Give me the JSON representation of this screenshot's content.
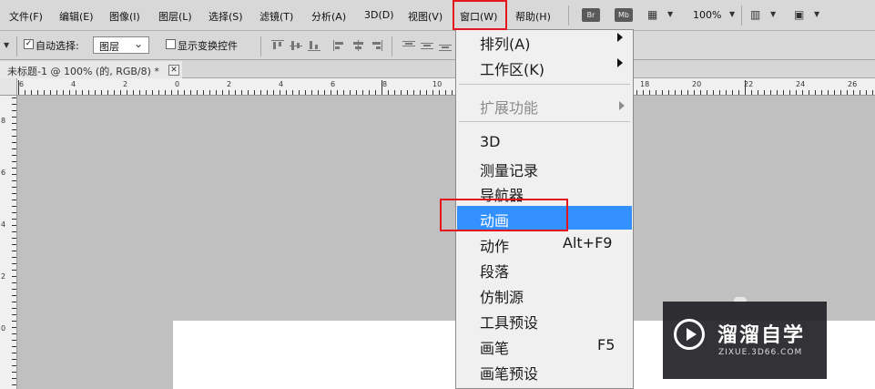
{
  "menubar": {
    "items": [
      "文件(F)",
      "编辑(E)",
      "图像(I)",
      "图层(L)",
      "选择(S)",
      "滤镜(T)",
      "分析(A)",
      "3D(D)",
      "视图(V)",
      "窗口(W)",
      "帮助(H)"
    ],
    "br_label": "Br",
    "mb_label": "Mb",
    "zoom": "100%"
  },
  "options": {
    "auto_select_label": "自动选择:",
    "layer_select_value": "图层",
    "show_transform_label": "显示变换控件"
  },
  "document_tab": {
    "title": "未标题-1 @ 100% (的, RGB/8) *",
    "close": "✕"
  },
  "ruler": {
    "h_labels": [
      "6",
      "4",
      "2",
      "0",
      "2",
      "4",
      "6",
      "8",
      "10",
      "18",
      "20",
      "22",
      "24",
      "26"
    ],
    "v_labels": [
      "8",
      "6",
      "4",
      "2",
      "0"
    ]
  },
  "window_menu": {
    "arrange": "排列(A)",
    "workspace": "工作区(K)",
    "extensions": "扩展功能",
    "items": [
      {
        "label": "3D",
        "shortcut": ""
      },
      {
        "label": "测量记录",
        "shortcut": ""
      },
      {
        "label": "导航器",
        "shortcut": ""
      },
      {
        "label": "动画",
        "shortcut": ""
      },
      {
        "label": "动作",
        "shortcut": "Alt+F9"
      },
      {
        "label": "段落",
        "shortcut": ""
      },
      {
        "label": "仿制源",
        "shortcut": ""
      },
      {
        "label": "工具预设",
        "shortcut": ""
      },
      {
        "label": "画笔",
        "shortcut": "F5"
      },
      {
        "label": "画笔预设",
        "shortcut": ""
      }
    ],
    "highlight_color": "#3391ff",
    "annotation_color": "#e2161c"
  },
  "watermark": {
    "brand": "溜溜自学",
    "url": "ZIXUE.3D66.COM"
  }
}
